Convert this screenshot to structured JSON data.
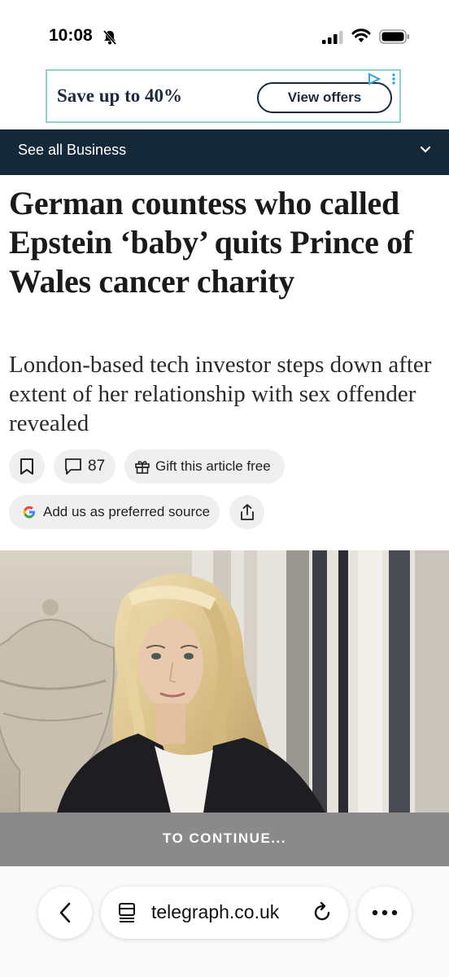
{
  "status_bar": {
    "time": "10:08"
  },
  "ad": {
    "text": "Save up to 40%",
    "button_label": "View offers"
  },
  "section_bar": {
    "label": "See all Business"
  },
  "article": {
    "headline": "German countess who called Epstein ‘baby’ quits Prince of Wales cancer charity",
    "standfirst": "London-based tech investor steps down after extent of her relationship with sex offender revealed"
  },
  "actions": {
    "comment_count": "87",
    "gift_label": "Gift this article free",
    "source_label": "Add us as preferred source"
  },
  "paywall": {
    "label": "TO CONTINUE..."
  },
  "browser": {
    "url": "telegraph.co.uk"
  },
  "colors": {
    "section_bar": "#142838",
    "ad_border": "#8fd3cc",
    "pill_bg": "#efefef"
  },
  "icons": [
    "bell-slash-icon",
    "signal-icon",
    "wifi-icon",
    "battery-icon",
    "ad-choices-icon",
    "chevron-down-icon",
    "bookmark-icon",
    "comment-icon",
    "gift-icon",
    "google-icon",
    "share-icon",
    "back-icon",
    "tabs-icon",
    "reload-icon",
    "more-icon"
  ]
}
